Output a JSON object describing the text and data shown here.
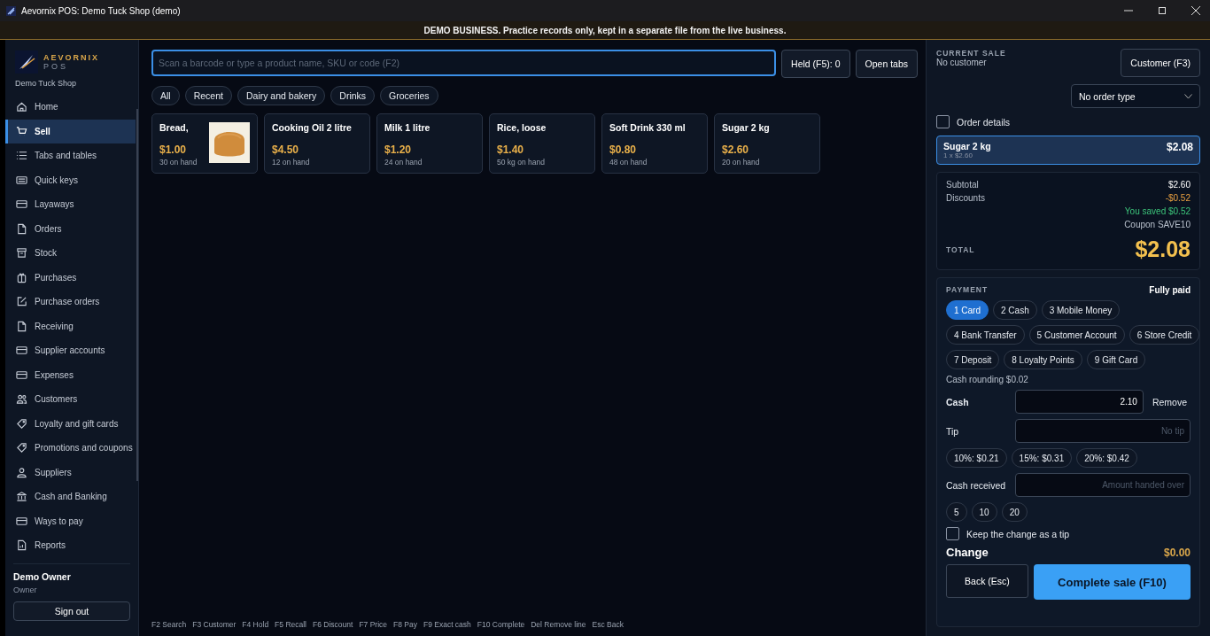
{
  "window": {
    "title": "Aevornix POS: Demo Tuck Shop (demo)"
  },
  "banner": "DEMO BUSINESS. Practice records only, kept in a separate file from the live business.",
  "brand": {
    "name": "AEVORNIX",
    "sub": "POS",
    "shop": "Demo Tuck Shop"
  },
  "sidebar": {
    "items": [
      {
        "label": "Home",
        "selected": false
      },
      {
        "label": "Sell",
        "selected": true
      },
      {
        "label": "Tabs and tables",
        "selected": false
      },
      {
        "label": "Quick keys",
        "selected": false
      },
      {
        "label": "Layaways",
        "selected": false
      },
      {
        "label": "Orders",
        "selected": false
      },
      {
        "label": "Stock",
        "selected": false
      },
      {
        "label": "Purchases",
        "selected": false
      },
      {
        "label": "Purchase orders",
        "selected": false
      },
      {
        "label": "Receiving",
        "selected": false
      },
      {
        "label": "Supplier accounts",
        "selected": false
      },
      {
        "label": "Expenses",
        "selected": false
      },
      {
        "label": "Customers",
        "selected": false
      },
      {
        "label": "Loyalty and gift cards",
        "selected": false
      },
      {
        "label": "Promotions and coupons",
        "selected": false
      },
      {
        "label": "Suppliers",
        "selected": false
      },
      {
        "label": "Cash and Banking",
        "selected": false
      },
      {
        "label": "Ways to pay",
        "selected": false
      },
      {
        "label": "Reports",
        "selected": false
      }
    ],
    "user": {
      "name": "Demo Owner",
      "role": "Owner"
    },
    "sign_out": "Sign out"
  },
  "search": {
    "placeholder": "Scan a barcode or type a product name, SKU or code (F2)"
  },
  "held_button": "Held (F5): 0",
  "open_tabs_button": "Open tabs",
  "categories": [
    "All",
    "Recent",
    "Dairy and bakery",
    "Drinks",
    "Groceries"
  ],
  "products": [
    {
      "name": "Bread,",
      "price": "$1.00",
      "stock": "30 on hand",
      "kind": "picture"
    },
    {
      "name": "Cooking Oil 2 litre",
      "price": "$4.50",
      "stock": "12 on hand"
    },
    {
      "name": "Milk 1 litre",
      "price": "$1.20",
      "stock": "24 on hand"
    },
    {
      "name": "Rice, loose",
      "price": "$1.40",
      "stock": "50 kg on hand"
    },
    {
      "name": "Soft Drink 330 ml",
      "price": "$0.80",
      "stock": "48 on hand"
    },
    {
      "name": "Sugar 2 kg",
      "price": "$2.60",
      "stock": "20 on hand"
    }
  ],
  "shortcuts": [
    "F2 Search",
    "F3 Customer",
    "F4 Hold",
    "F5 Recall",
    "F6 Discount",
    "F7 Price",
    "F8 Pay",
    "F9 Exact cash",
    "F10 Complete",
    "Del Remove line",
    "Esc Back"
  ],
  "sale": {
    "heading": "CURRENT SALE",
    "customer": "No customer",
    "customer_button": "Customer (F3)",
    "order_type": "No order type",
    "order_details": {
      "label": "Order details",
      "checked": false
    },
    "lines": [
      {
        "name": "Sugar 2 kg",
        "detail": "1 x $2.60",
        "amount": "$2.08",
        "selected": true
      }
    ],
    "totals": [
      {
        "label": "Subtotal",
        "value": "$2.60",
        "kind": "normal"
      },
      {
        "label": "Discounts",
        "value": "-$0.52",
        "kind": "discount"
      }
    ],
    "notes": [
      {
        "text": "You saved $0.52",
        "kind": "saved"
      },
      {
        "text": "Coupon SAVE10",
        "kind": "plain"
      }
    ],
    "total_label": "TOTAL",
    "total": "$2.08"
  },
  "payment": {
    "heading": "PAYMENT",
    "status": "Fully paid",
    "methods": [
      [
        {
          "label": "1 Card",
          "selected": true
        },
        {
          "label": "2 Cash",
          "selected": false
        },
        {
          "label": "3 Mobile Money",
          "selected": false
        }
      ],
      [
        {
          "label": "4 Bank Transfer",
          "selected": false
        },
        {
          "label": "5 Customer Account",
          "selected": false
        },
        {
          "label": "6 Store Credit",
          "selected": false
        }
      ],
      [
        {
          "label": "7 Deposit",
          "selected": false
        },
        {
          "label": "8 Loyalty Points",
          "selected": false
        },
        {
          "label": "9 Gift Card",
          "selected": false
        }
      ]
    ],
    "rounding": "Cash rounding $0.02",
    "cash": {
      "label": "Cash",
      "value": "2.10",
      "remove": "Remove"
    },
    "tip": {
      "label": "Tip",
      "placeholder": "No tip",
      "presets": [
        "10%: $0.21",
        "15%: $0.31",
        "20%: $0.42"
      ]
    },
    "received": {
      "label": "Cash received",
      "placeholder": "Amount handed over",
      "presets": [
        "5",
        "10",
        "20"
      ]
    },
    "keep_change": {
      "label": "Keep the change as a tip",
      "checked": false
    },
    "change_label": "Change",
    "change": "$0.00",
    "back_button": "Back (Esc)",
    "complete_button": "Complete sale (F10)"
  }
}
